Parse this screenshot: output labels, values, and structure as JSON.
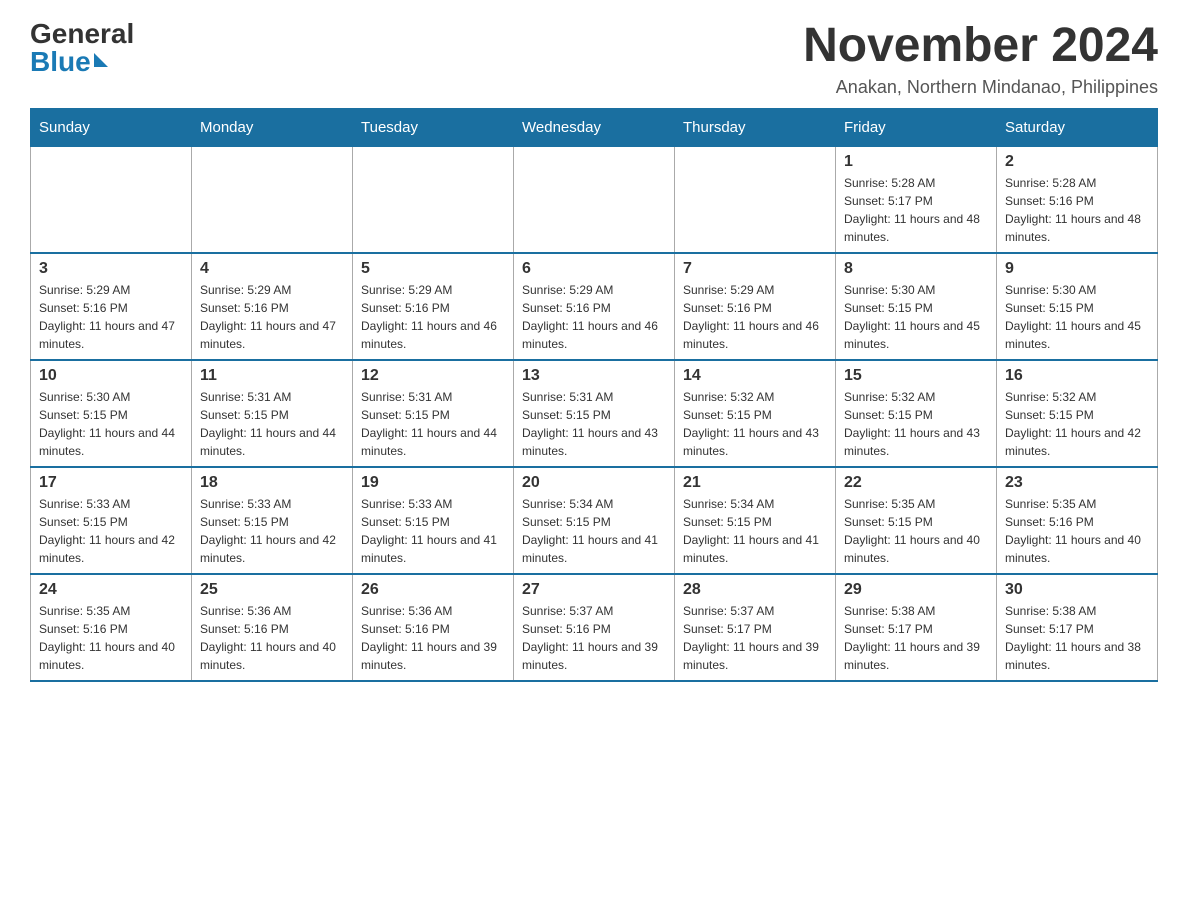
{
  "logo": {
    "general": "General",
    "blue": "Blue"
  },
  "title": {
    "month_year": "November 2024",
    "location": "Anakan, Northern Mindanao, Philippines"
  },
  "header_days": [
    "Sunday",
    "Monday",
    "Tuesday",
    "Wednesday",
    "Thursday",
    "Friday",
    "Saturday"
  ],
  "weeks": [
    [
      {
        "day": "",
        "info": ""
      },
      {
        "day": "",
        "info": ""
      },
      {
        "day": "",
        "info": ""
      },
      {
        "day": "",
        "info": ""
      },
      {
        "day": "",
        "info": ""
      },
      {
        "day": "1",
        "info": "Sunrise: 5:28 AM\nSunset: 5:17 PM\nDaylight: 11 hours and 48 minutes."
      },
      {
        "day": "2",
        "info": "Sunrise: 5:28 AM\nSunset: 5:16 PM\nDaylight: 11 hours and 48 minutes."
      }
    ],
    [
      {
        "day": "3",
        "info": "Sunrise: 5:29 AM\nSunset: 5:16 PM\nDaylight: 11 hours and 47 minutes."
      },
      {
        "day": "4",
        "info": "Sunrise: 5:29 AM\nSunset: 5:16 PM\nDaylight: 11 hours and 47 minutes."
      },
      {
        "day": "5",
        "info": "Sunrise: 5:29 AM\nSunset: 5:16 PM\nDaylight: 11 hours and 46 minutes."
      },
      {
        "day": "6",
        "info": "Sunrise: 5:29 AM\nSunset: 5:16 PM\nDaylight: 11 hours and 46 minutes."
      },
      {
        "day": "7",
        "info": "Sunrise: 5:29 AM\nSunset: 5:16 PM\nDaylight: 11 hours and 46 minutes."
      },
      {
        "day": "8",
        "info": "Sunrise: 5:30 AM\nSunset: 5:15 PM\nDaylight: 11 hours and 45 minutes."
      },
      {
        "day": "9",
        "info": "Sunrise: 5:30 AM\nSunset: 5:15 PM\nDaylight: 11 hours and 45 minutes."
      }
    ],
    [
      {
        "day": "10",
        "info": "Sunrise: 5:30 AM\nSunset: 5:15 PM\nDaylight: 11 hours and 44 minutes."
      },
      {
        "day": "11",
        "info": "Sunrise: 5:31 AM\nSunset: 5:15 PM\nDaylight: 11 hours and 44 minutes."
      },
      {
        "day": "12",
        "info": "Sunrise: 5:31 AM\nSunset: 5:15 PM\nDaylight: 11 hours and 44 minutes."
      },
      {
        "day": "13",
        "info": "Sunrise: 5:31 AM\nSunset: 5:15 PM\nDaylight: 11 hours and 43 minutes."
      },
      {
        "day": "14",
        "info": "Sunrise: 5:32 AM\nSunset: 5:15 PM\nDaylight: 11 hours and 43 minutes."
      },
      {
        "day": "15",
        "info": "Sunrise: 5:32 AM\nSunset: 5:15 PM\nDaylight: 11 hours and 43 minutes."
      },
      {
        "day": "16",
        "info": "Sunrise: 5:32 AM\nSunset: 5:15 PM\nDaylight: 11 hours and 42 minutes."
      }
    ],
    [
      {
        "day": "17",
        "info": "Sunrise: 5:33 AM\nSunset: 5:15 PM\nDaylight: 11 hours and 42 minutes."
      },
      {
        "day": "18",
        "info": "Sunrise: 5:33 AM\nSunset: 5:15 PM\nDaylight: 11 hours and 42 minutes."
      },
      {
        "day": "19",
        "info": "Sunrise: 5:33 AM\nSunset: 5:15 PM\nDaylight: 11 hours and 41 minutes."
      },
      {
        "day": "20",
        "info": "Sunrise: 5:34 AM\nSunset: 5:15 PM\nDaylight: 11 hours and 41 minutes."
      },
      {
        "day": "21",
        "info": "Sunrise: 5:34 AM\nSunset: 5:15 PM\nDaylight: 11 hours and 41 minutes."
      },
      {
        "day": "22",
        "info": "Sunrise: 5:35 AM\nSunset: 5:15 PM\nDaylight: 11 hours and 40 minutes."
      },
      {
        "day": "23",
        "info": "Sunrise: 5:35 AM\nSunset: 5:16 PM\nDaylight: 11 hours and 40 minutes."
      }
    ],
    [
      {
        "day": "24",
        "info": "Sunrise: 5:35 AM\nSunset: 5:16 PM\nDaylight: 11 hours and 40 minutes."
      },
      {
        "day": "25",
        "info": "Sunrise: 5:36 AM\nSunset: 5:16 PM\nDaylight: 11 hours and 40 minutes."
      },
      {
        "day": "26",
        "info": "Sunrise: 5:36 AM\nSunset: 5:16 PM\nDaylight: 11 hours and 39 minutes."
      },
      {
        "day": "27",
        "info": "Sunrise: 5:37 AM\nSunset: 5:16 PM\nDaylight: 11 hours and 39 minutes."
      },
      {
        "day": "28",
        "info": "Sunrise: 5:37 AM\nSunset: 5:17 PM\nDaylight: 11 hours and 39 minutes."
      },
      {
        "day": "29",
        "info": "Sunrise: 5:38 AM\nSunset: 5:17 PM\nDaylight: 11 hours and 39 minutes."
      },
      {
        "day": "30",
        "info": "Sunrise: 5:38 AM\nSunset: 5:17 PM\nDaylight: 11 hours and 38 minutes."
      }
    ]
  ]
}
